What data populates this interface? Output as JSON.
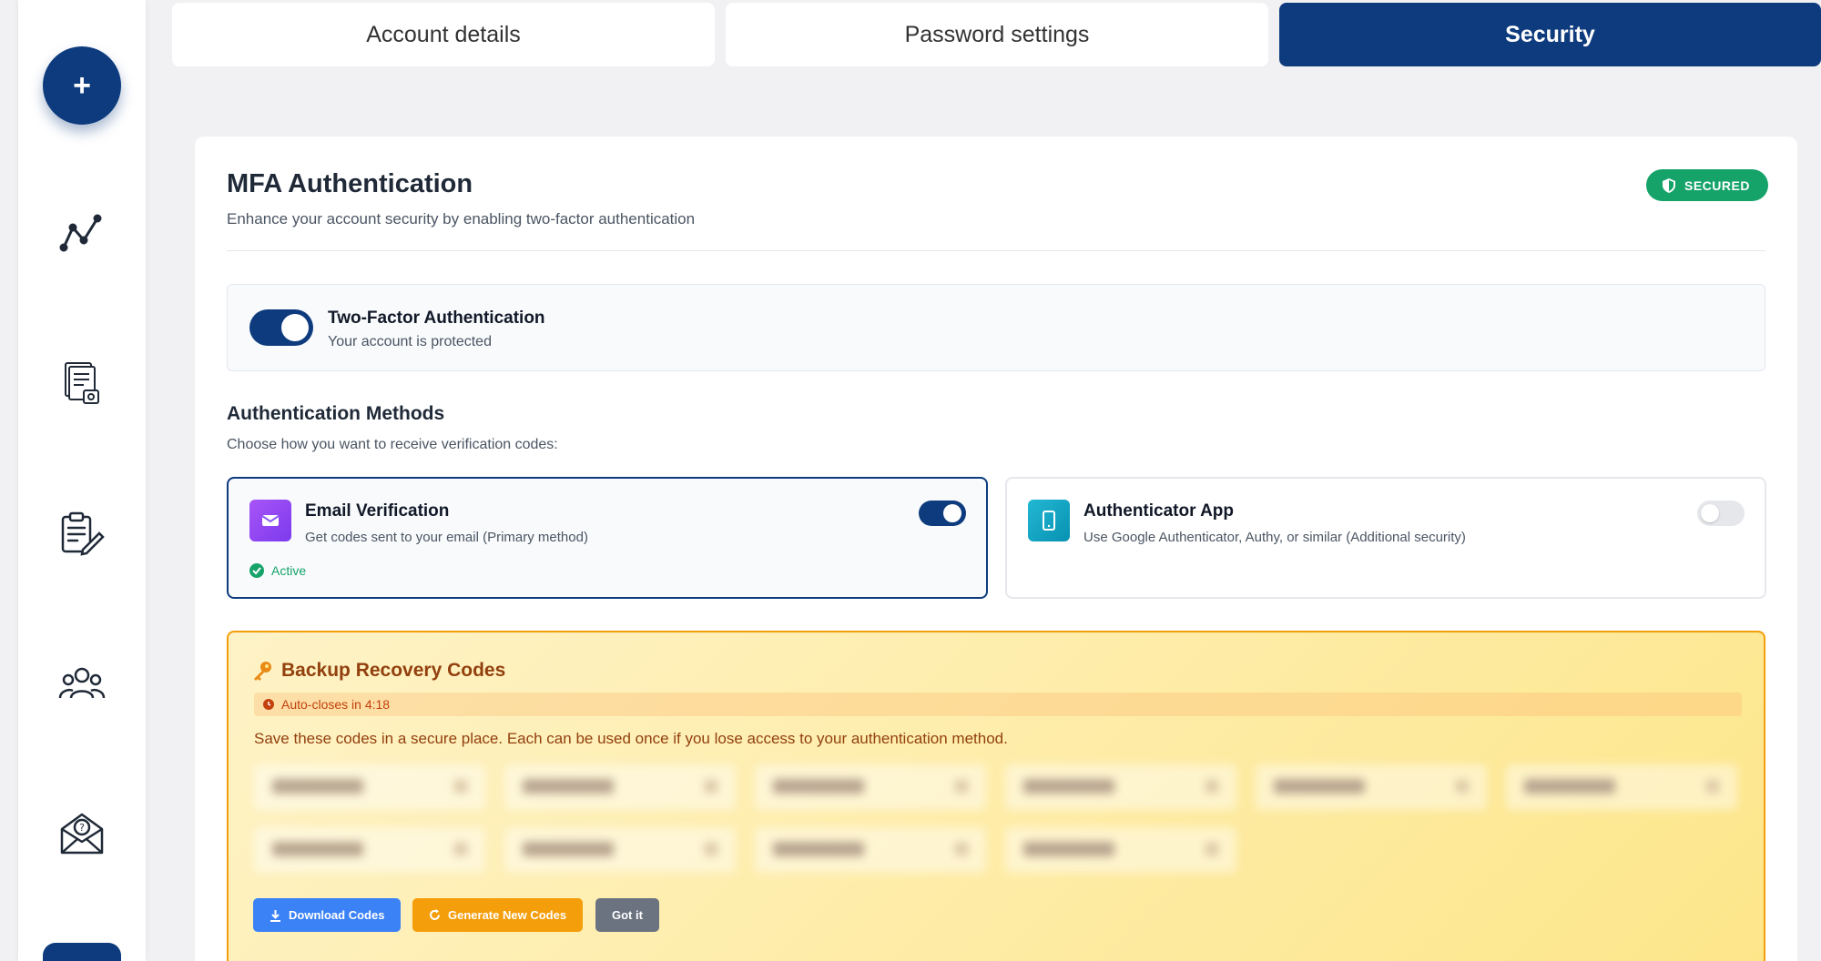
{
  "tabs": [
    {
      "label": "Account details",
      "active": false
    },
    {
      "label": "Password settings",
      "active": false
    },
    {
      "label": "Security",
      "active": true
    }
  ],
  "sidebar": {
    "fab_label": "+",
    "icons": [
      "analytics-icon",
      "documents-icon",
      "edit-clipboard-icon",
      "team-icon",
      "support-mail-icon"
    ]
  },
  "mfa": {
    "title": "MFA Authentication",
    "subtitle": "Enhance your account security by enabling two-factor authentication",
    "badge": "SECURED",
    "two_factor": {
      "title": "Two-Factor Authentication",
      "status": "Your account is protected",
      "enabled": true
    }
  },
  "methods": {
    "title": "Authentication Methods",
    "subtitle": "Choose how you want to receive verification codes:",
    "email": {
      "title": "Email Verification",
      "desc": "Get codes sent to your email (Primary method)",
      "status": "Active",
      "enabled": true
    },
    "app": {
      "title": "Authenticator App",
      "desc": "Use Google Authenticator, Authy, or similar (Additional security)",
      "enabled": false
    }
  },
  "backup": {
    "title": "Backup Recovery Codes",
    "timer": "Auto-closes in 4:18",
    "desc": "Save these codes in a secure place. Each can be used once if you lose access to your authentication method.",
    "buttons": {
      "download": "Download Codes",
      "generate": "Generate New Codes",
      "got_it": "Got it"
    }
  },
  "colors": {
    "primary": "#0d3b7d",
    "success": "#16a36a",
    "email_icon": "#8b5cf6",
    "app_icon": "#0ea5c6",
    "warning_border": "#f59e0b",
    "download_btn": "#3b82f6",
    "generate_btn": "#f59e0b",
    "gotit_btn": "#6b7280"
  }
}
